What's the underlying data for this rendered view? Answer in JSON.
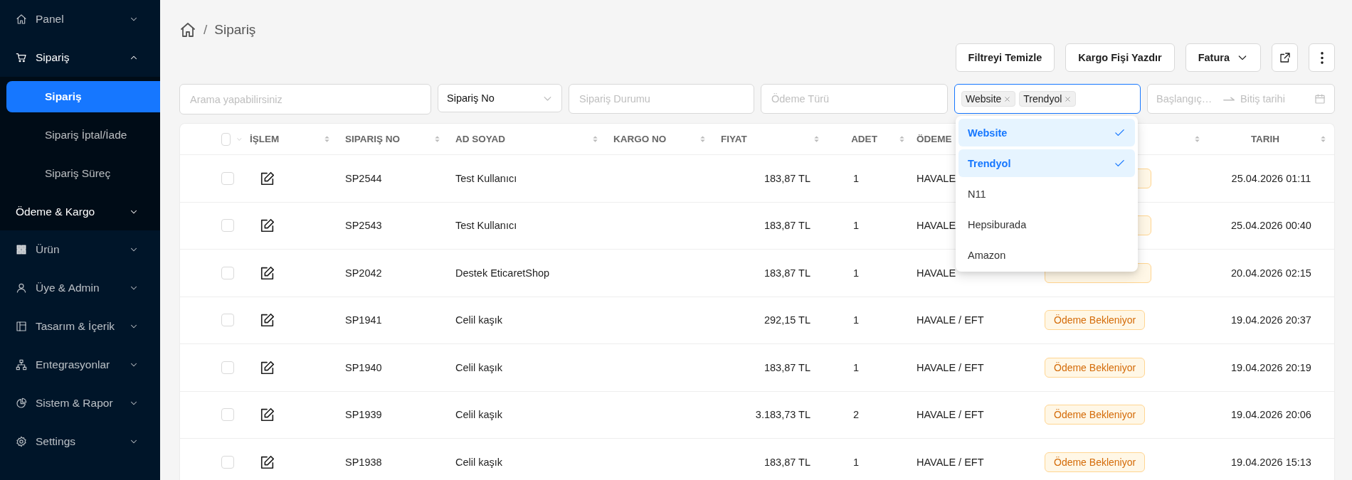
{
  "sidebar": {
    "items": [
      {
        "label": "Panel",
        "expanded": false
      },
      {
        "label": "Sipariş",
        "expanded": true,
        "children": [
          {
            "kind": "link",
            "label": "Sipariş",
            "selected": true
          },
          {
            "kind": "link",
            "label": "Sipariş İptal/İade",
            "selected": false
          },
          {
            "kind": "link",
            "label": "Sipariş Süreç",
            "selected": false
          },
          {
            "kind": "group",
            "label": "Ödeme & Kargo",
            "expanded": false
          }
        ]
      },
      {
        "label": "Ürün",
        "expanded": false
      },
      {
        "label": "Üye & Admin",
        "expanded": false
      },
      {
        "label": "Tasarım & İçerik",
        "expanded": false
      },
      {
        "label": "Entegrasyonlar",
        "expanded": false
      },
      {
        "label": "Sistem & Rapor",
        "expanded": false
      },
      {
        "label": "Settings",
        "expanded": false
      }
    ]
  },
  "breadcrumb": {
    "separator": "/",
    "label": "Sipariş"
  },
  "toolbar": {
    "buttons": [
      {
        "kind": "text",
        "label": "Filtreyi Temizle"
      },
      {
        "kind": "text",
        "label": "Kargo Fişi Yazdır"
      },
      {
        "kind": "dropdown",
        "label": "Fatura"
      },
      {
        "kind": "export"
      },
      {
        "kind": "more"
      }
    ]
  },
  "filters": [
    {
      "kind": "search",
      "placeholder": "Arama yapabilirsiniz"
    },
    {
      "kind": "select",
      "value": "Sipariş No"
    },
    {
      "kind": "input",
      "placeholder": "Sipariş Durumu"
    },
    {
      "kind": "input",
      "placeholder": "Ödeme Türü"
    },
    {
      "kind": "tags",
      "tags": [
        "Website",
        "Trendyol"
      ],
      "expanded": true,
      "options": [
        {
          "label": "Website",
          "selected": true
        },
        {
          "label": "Trendyol",
          "selected": true
        },
        {
          "label": "N11",
          "selected": false
        },
        {
          "label": "Hepsiburada",
          "selected": false
        },
        {
          "label": "Amazon",
          "selected": false
        }
      ]
    },
    {
      "kind": "daterange",
      "start_placeholder": "Başlangıç…",
      "end_placeholder": "Bitiş tarihi"
    }
  ],
  "table": {
    "select_all": {
      "checked": false
    },
    "columns": [
      {
        "label": "İŞLEM"
      },
      {
        "label": "SIPARIŞ NO"
      },
      {
        "label": "AD SOYAD"
      },
      {
        "label": "KARGO NO"
      },
      {
        "label": "FIYAT"
      },
      {
        "label": "ADET"
      },
      {
        "label": "ÖDEME"
      },
      {},
      {
        "label": "TARIH"
      }
    ],
    "rows": [
      {
        "checked": false,
        "order_no": "SP2544",
        "name": "Test Kullanıcı",
        "price": "183,87 TL",
        "qty": "1",
        "payment": "HAVALE",
        "badge": true,
        "date": "25.04.2026 01:11"
      },
      {
        "checked": false,
        "order_no": "SP2543",
        "name": "Test Kullanıcı",
        "price": "183,87 TL",
        "qty": "1",
        "payment": "HAVALE",
        "badge": true,
        "date": "25.04.2026 00:40"
      },
      {
        "checked": false,
        "order_no": "SP2042",
        "name": "Destek EticaretShop",
        "price": "183,87 TL",
        "qty": "1",
        "payment": "HAVALE",
        "badge": true,
        "date": "20.04.2026 02:15"
      },
      {
        "checked": false,
        "order_no": "SP1941",
        "name": "Celil kaşık",
        "price": "292,15 TL",
        "qty": "1",
        "payment": "HAVALE / EFT",
        "status": "Ödeme Bekleniyor",
        "date": "19.04.2026 20:37"
      },
      {
        "checked": false,
        "order_no": "SP1940",
        "name": "Celil kaşık",
        "price": "183,87 TL",
        "qty": "1",
        "payment": "HAVALE / EFT",
        "status": "Ödeme Bekleniyor",
        "date": "19.04.2026 20:19"
      },
      {
        "checked": false,
        "order_no": "SP1939",
        "name": "Celil kaşık",
        "price": "3.183,73 TL",
        "qty": "2",
        "payment": "HAVALE / EFT",
        "status": "Ödeme Bekleniyor",
        "date": "19.04.2026 20:06"
      },
      {
        "checked": false,
        "order_no": "SP1938",
        "name": "Celil kaşık",
        "price": "183,87 TL",
        "qty": "1",
        "payment": "HAVALE / EFT",
        "status": "Ödeme Bekleniyor",
        "date": "19.04.2026 15:13"
      }
    ]
  }
}
